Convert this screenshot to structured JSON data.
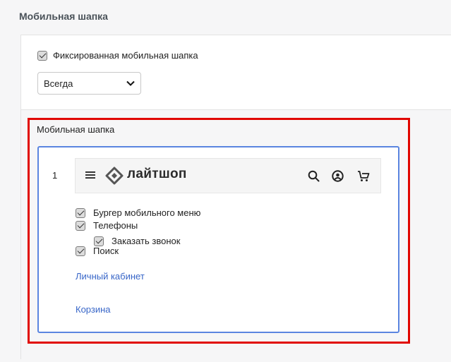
{
  "section_title": "Мобильная шапка",
  "fixed_header": {
    "label": "Фиксированная мобильная шапка",
    "checked": true
  },
  "mode_select": {
    "value": "Всегда"
  },
  "mobile_header": {
    "label": "Мобильная шапка",
    "row_number": "1",
    "logo_text": "лайтшоп",
    "icons": [
      "burger-icon",
      "logo-icon",
      "search-icon",
      "user-icon",
      "cart-icon"
    ],
    "options": [
      {
        "label": "Бургер мобильного меню",
        "checked": true
      },
      {
        "label": "Телефоны",
        "checked": true
      },
      {
        "label": "Заказать звонок",
        "checked": true
      },
      {
        "label": "Поиск",
        "checked": true
      }
    ],
    "links": {
      "account": "Личный кабинет",
      "cart": "Корзина"
    }
  },
  "colors": {
    "highlight": "#e10600",
    "editor_border": "#5a85e0",
    "link": "#3866c8"
  }
}
